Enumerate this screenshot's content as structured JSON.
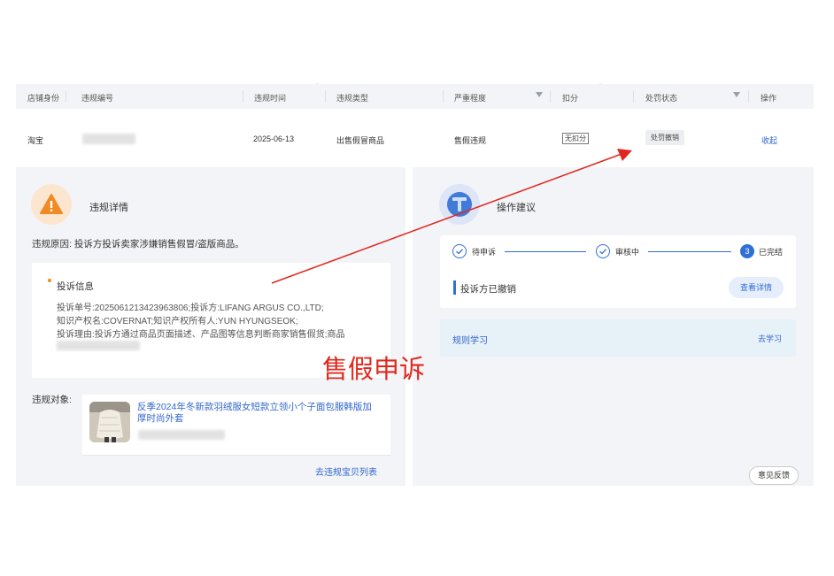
{
  "table": {
    "headers": {
      "shop_identity": "店铺身份",
      "violation_id": "违规编号",
      "violation_time": "违规时间",
      "violation_type": "违规类型",
      "severity": "严重程度",
      "points": "扣分",
      "penalty_status": "处罚状态",
      "action": "操作"
    },
    "row": {
      "shop_identity": "淘宝",
      "violation_time": "2025-06-13",
      "violation_type": "出售假冒商品",
      "severity": "售假违规",
      "points": "无扣分",
      "penalty_status": "处罚撤销",
      "action": "收起"
    }
  },
  "detail": {
    "title": "违规详情",
    "reason_label": "违规原因:",
    "reason_text": "投诉方投诉卖家涉嫌销售假冒/盗版商品。",
    "info_title": "投诉信息",
    "info_line1": "投诉单号:2025061213423963806;投诉方:LIFANG ARGUS CO.,LTD;",
    "info_line2": "知识产权名:COVERNAT;知识产权所有人:YUN HYUNGSEOK;",
    "info_line3": "投诉理由:投诉方通过商品页面描述、产品图等信息判断商家销售假货;商品",
    "object_label": "违规对象:",
    "product_title_line1": "反季2024年冬新款羽绒服女短款立领小个子面包服韩版加",
    "product_title_line2": "厚时尚外套",
    "list_link": "去违规宝贝列表"
  },
  "advice": {
    "title": "操作建议",
    "steps": [
      "待申诉",
      "审核中",
      "已完结"
    ],
    "step3_number": "3",
    "status_text": "投诉方已撤销",
    "detail_button": "查看详情",
    "rule_label": "规则学习",
    "rule_link": "去学习",
    "feedback_button": "意见反馈"
  },
  "annotation": {
    "text": "售假申诉",
    "color": "#e0281e"
  },
  "colors": {
    "accent": "#3366cc",
    "warning": "#f08a24",
    "done_step": "#2f6fd6"
  }
}
